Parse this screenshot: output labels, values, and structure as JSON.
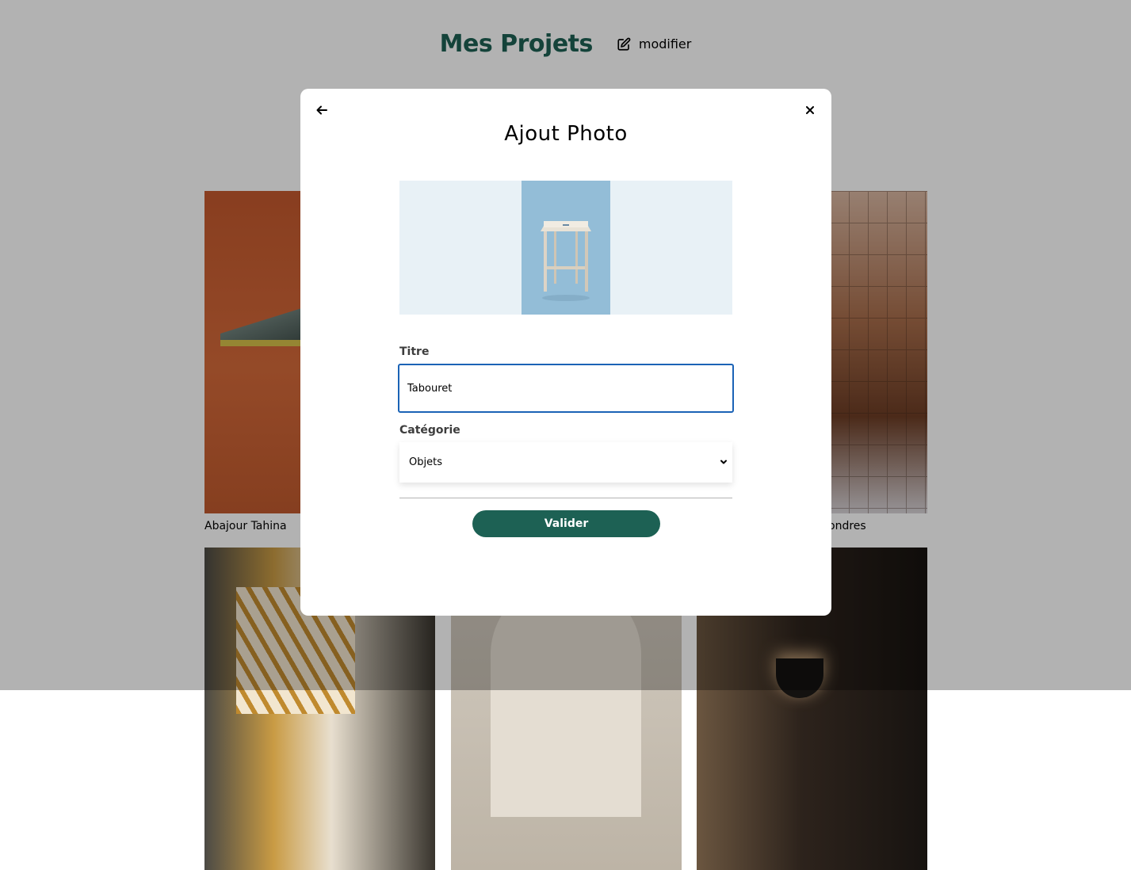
{
  "page": {
    "title": "Mes Projets",
    "edit_label": "modifier",
    "icons": {
      "edit": "pen-to-square-icon"
    }
  },
  "gallery": {
    "items": [
      {
        "caption": "Abajour Tahina",
        "image": "pendant-lamp-orange-wall"
      },
      {
        "caption": "",
        "image": "hidden-behind-modal"
      },
      {
        "caption": "ondres",
        "image": "restaurant-interior-plants"
      },
      {
        "caption": "",
        "image": "wooden-shelf-lattice"
      },
      {
        "caption": "",
        "image": "arch-neutral-room"
      },
      {
        "caption": "",
        "image": "dark-interior-lamp"
      }
    ]
  },
  "modal": {
    "title": "Ajout Photo",
    "back_icon": "arrow-left-icon",
    "close_icon": "close-icon",
    "preview_image": "wooden-stool-blue-background",
    "form": {
      "title_label": "Titre",
      "title_value": "Tabouret",
      "category_label": "Catégorie",
      "category_value": "Objets",
      "submit_label": "Valider"
    }
  },
  "colors": {
    "accent": "#1d6154",
    "input_focus": "#1b63b6",
    "upload_bg": "#e8f1f6",
    "overlay": "rgba(0,0,0,0.3)"
  }
}
